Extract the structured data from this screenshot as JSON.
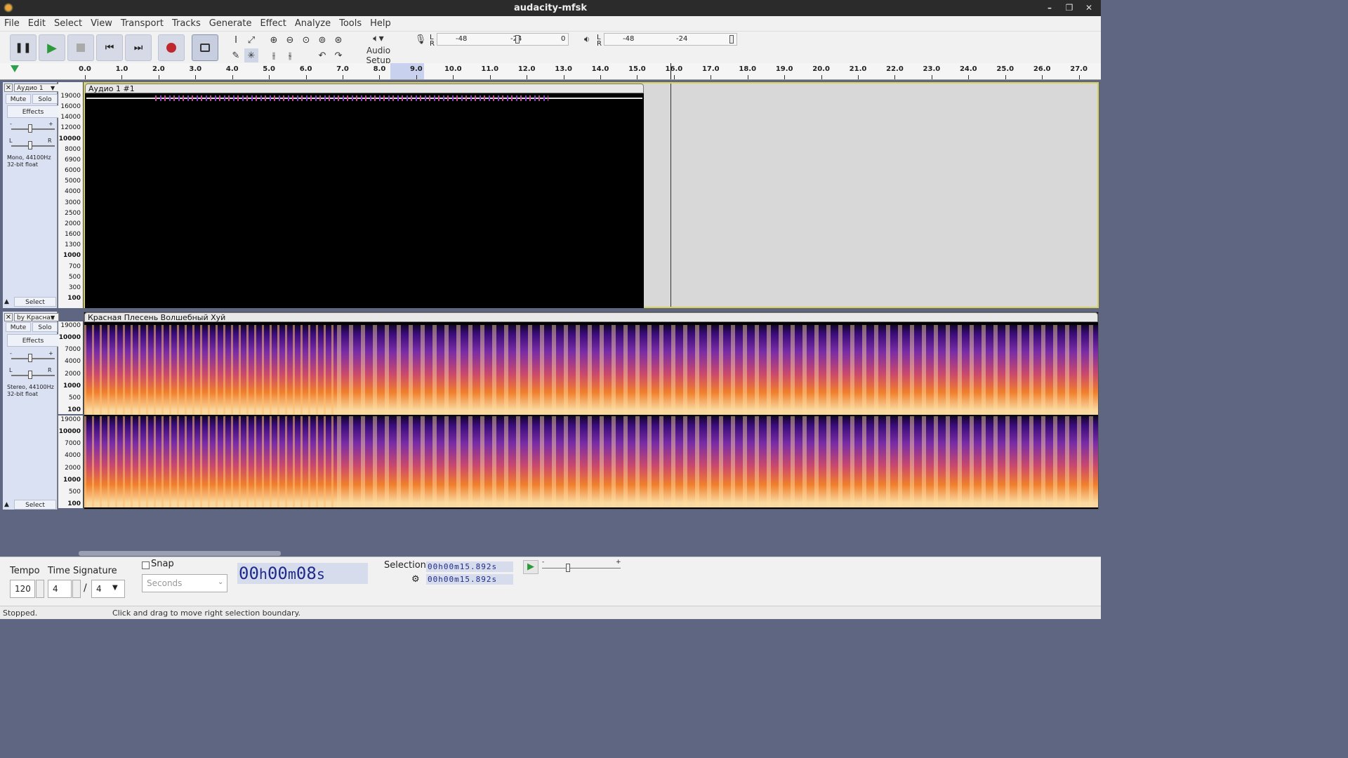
{
  "window": {
    "title": "audacity-mfsk"
  },
  "menus": [
    "File",
    "Edit",
    "Select",
    "View",
    "Transport",
    "Tracks",
    "Generate",
    "Effect",
    "Analyze",
    "Tools",
    "Help"
  ],
  "toolbar": {
    "audio_setup": "Audio Setup",
    "rec_meter": {
      "l": "L",
      "r": "R",
      "m48": "-48",
      "m24": "-24",
      "zero": "0"
    },
    "play_meter": {
      "l": "L",
      "r": "R",
      "m48": "-48",
      "m24": "-24"
    }
  },
  "ruler": {
    "ticks": [
      "0.0",
      "1.0",
      "2.0",
      "3.0",
      "4.0",
      "5.0",
      "6.0",
      "7.0",
      "8.0",
      "9.0",
      "10.0",
      "11.0",
      "12.0",
      "13.0",
      "14.0",
      "15.0",
      "16.0",
      "17.0",
      "18.0",
      "19.0",
      "20.0",
      "21.0",
      "22.0",
      "23.0",
      "24.0",
      "25.0",
      "26.0",
      "27.0"
    ]
  },
  "tracks": [
    {
      "name": "Аудио 1",
      "clip": "Аудио 1 #1",
      "mute": "Mute",
      "solo": "Solo",
      "effects": "Effects",
      "select": "Select",
      "info1": "Mono, 44100Hz",
      "info2": "32-bit float",
      "minus": "-",
      "plus": "+",
      "l": "L",
      "r": "R",
      "y_labels": [
        "19000",
        "16000",
        "14000",
        "12000",
        "10000",
        "8000",
        "6900",
        "6000",
        "5000",
        "4000",
        "3000",
        "2500",
        "2000",
        "1600",
        "1300",
        "1000",
        "700",
        "500",
        "300",
        "100"
      ]
    },
    {
      "name": "by Красная",
      "clip": "Красная Плесень Волшебный Хуй",
      "mute": "Mute",
      "solo": "Solo",
      "effects": "Effects",
      "select": "Select",
      "info1": "Stereo, 44100Hz",
      "info2": "32-bit float",
      "minus": "-",
      "plus": "+",
      "l": "L",
      "r": "R",
      "y_labels": [
        "19000",
        "10000",
        "7000",
        "4000",
        "2000",
        "1000",
        "500",
        "100"
      ]
    }
  ],
  "bottom": {
    "tempo_label": "Tempo",
    "tempo": "120",
    "timesig_label": "Time Signature",
    "ts_num": "4",
    "ts_slash": "/",
    "ts_den": "4",
    "snap": "Snap",
    "snap_unit": "Seconds",
    "time": {
      "h": "00",
      "hl": "h",
      "m": "00",
      "ml": "m",
      "s": "08",
      "sl": "s"
    },
    "selection_label": "Selection",
    "sel_start": "00h00m15.892s",
    "sel_end": "00h00m15.892s",
    "speed_minus": "-",
    "speed_plus": "+"
  },
  "status": {
    "state": "Stopped.",
    "hint": "Click and drag to move right selection boundary."
  },
  "colors": {
    "accent": "#d5dae6",
    "track_panel": "#d9e1f3",
    "selection_outline": "#e8e060"
  }
}
